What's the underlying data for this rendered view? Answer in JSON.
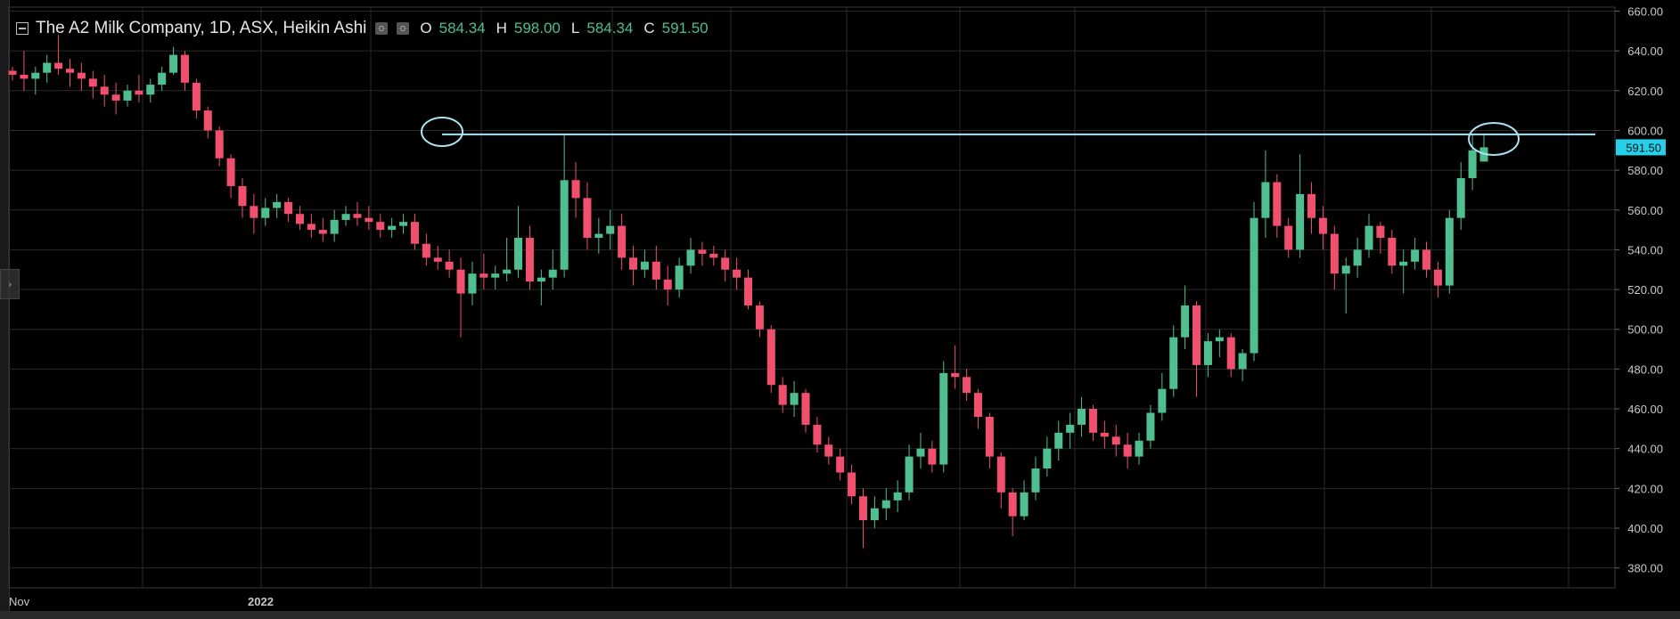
{
  "legend": {
    "title": "The A2 Milk Company, 1D, ASX, Heikin Ashi",
    "open_key": "O",
    "open_val": "584.34",
    "high_key": "H",
    "high_val": "598.00",
    "low_key": "L",
    "low_val": "584.34",
    "close_key": "C",
    "close_val": "591.50"
  },
  "colors": {
    "up": "#4fbf8f",
    "down": "#f0506e",
    "grid": "#2a2a2a",
    "annotation": "#a8e4f4",
    "axis_text": "#c8c8c8",
    "price_tag_bg": "#26d0e8"
  },
  "chart_data": {
    "type": "candlestick",
    "title": "The A2 Milk Company, 1D, ASX, Heikin Ashi",
    "ylim": [
      370,
      662
    ],
    "yticks": [
      "660.00",
      "640.00",
      "620.00",
      "600.00",
      "580.00",
      "560.00",
      "540.00",
      "520.00",
      "500.00",
      "480.00",
      "460.00",
      "440.00",
      "420.00",
      "400.00",
      "380.00"
    ],
    "xtick_labels": [
      "Nov",
      "2022"
    ],
    "last_price": "591.50",
    "resistance_level": 598,
    "annotations": [
      "horizontal line at ~598 with circles at prior high and current high"
    ],
    "ohlc": [
      [
        630,
        632,
        625,
        628
      ],
      [
        628,
        640,
        620,
        626
      ],
      [
        626,
        632,
        618,
        629
      ],
      [
        629,
        638,
        624,
        634
      ],
      [
        634,
        648,
        628,
        631
      ],
      [
        631,
        636,
        622,
        629
      ],
      [
        629,
        634,
        620,
        626
      ],
      [
        626,
        630,
        616,
        622
      ],
      [
        622,
        628,
        612,
        618
      ],
      [
        618,
        624,
        608,
        615
      ],
      [
        615,
        623,
        612,
        620
      ],
      [
        620,
        628,
        614,
        618
      ],
      [
        618,
        626,
        614,
        623
      ],
      [
        623,
        632,
        620,
        629
      ],
      [
        629,
        642,
        628,
        638
      ],
      [
        638,
        640,
        620,
        624
      ],
      [
        624,
        626,
        606,
        610
      ],
      [
        610,
        612,
        596,
        600
      ],
      [
        600,
        602,
        582,
        586
      ],
      [
        586,
        588,
        566,
        572
      ],
      [
        572,
        576,
        556,
        562
      ],
      [
        562,
        568,
        548,
        556
      ],
      [
        556,
        566,
        552,
        561
      ],
      [
        561,
        568,
        556,
        564
      ],
      [
        564,
        566,
        554,
        558
      ],
      [
        558,
        562,
        550,
        553
      ],
      [
        553,
        558,
        546,
        550
      ],
      [
        550,
        556,
        544,
        548
      ],
      [
        548,
        560,
        544,
        555
      ],
      [
        555,
        562,
        552,
        558
      ],
      [
        558,
        564,
        552,
        556
      ],
      [
        556,
        562,
        550,
        554
      ],
      [
        554,
        558,
        546,
        550
      ],
      [
        550,
        556,
        546,
        552
      ],
      [
        552,
        558,
        548,
        554
      ],
      [
        554,
        558,
        540,
        543
      ],
      [
        543,
        548,
        532,
        536
      ],
      [
        536,
        542,
        530,
        534
      ],
      [
        534,
        540,
        526,
        530
      ],
      [
        530,
        536,
        496,
        518
      ],
      [
        518,
        534,
        512,
        528
      ],
      [
        528,
        538,
        520,
        526
      ],
      [
        526,
        532,
        520,
        528
      ],
      [
        528,
        546,
        524,
        530
      ],
      [
        530,
        562,
        526,
        546
      ],
      [
        546,
        552,
        520,
        524
      ],
      [
        524,
        530,
        512,
        526
      ],
      [
        526,
        540,
        520,
        530
      ],
      [
        530,
        598,
        526,
        575
      ],
      [
        575,
        584,
        556,
        566
      ],
      [
        566,
        574,
        540,
        546
      ],
      [
        546,
        556,
        538,
        548
      ],
      [
        548,
        560,
        540,
        552
      ],
      [
        552,
        558,
        530,
        536
      ],
      [
        536,
        542,
        522,
        530
      ],
      [
        530,
        540,
        526,
        534
      ],
      [
        534,
        542,
        520,
        525
      ],
      [
        525,
        532,
        512,
        520
      ],
      [
        520,
        536,
        516,
        532
      ],
      [
        532,
        546,
        528,
        540
      ],
      [
        540,
        544,
        532,
        538
      ],
      [
        538,
        542,
        532,
        536
      ],
      [
        536,
        540,
        524,
        530
      ],
      [
        530,
        536,
        520,
        526
      ],
      [
        526,
        530,
        510,
        512
      ],
      [
        512,
        514,
        496,
        500
      ],
      [
        500,
        502,
        468,
        472
      ],
      [
        472,
        476,
        458,
        462
      ],
      [
        462,
        474,
        456,
        468
      ],
      [
        468,
        470,
        448,
        452
      ],
      [
        452,
        456,
        438,
        442
      ],
      [
        442,
        446,
        432,
        436
      ],
      [
        436,
        440,
        424,
        428
      ],
      [
        428,
        432,
        412,
        416
      ],
      [
        416,
        420,
        390,
        404
      ],
      [
        404,
        416,
        400,
        410
      ],
      [
        410,
        420,
        404,
        414
      ],
      [
        414,
        424,
        408,
        418
      ],
      [
        418,
        442,
        414,
        436
      ],
      [
        436,
        448,
        430,
        440
      ],
      [
        440,
        444,
        428,
        432
      ],
      [
        432,
        484,
        428,
        478
      ],
      [
        478,
        492,
        470,
        476
      ],
      [
        476,
        480,
        464,
        468
      ],
      [
        468,
        470,
        450,
        456
      ],
      [
        456,
        458,
        430,
        436
      ],
      [
        436,
        438,
        410,
        418
      ],
      [
        418,
        420,
        396,
        406
      ],
      [
        406,
        424,
        404,
        418
      ],
      [
        418,
        436,
        414,
        430
      ],
      [
        430,
        446,
        426,
        440
      ],
      [
        440,
        454,
        434,
        448
      ],
      [
        448,
        458,
        440,
        452
      ],
      [
        452,
        466,
        446,
        460
      ],
      [
        460,
        462,
        444,
        448
      ],
      [
        448,
        454,
        440,
        446
      ],
      [
        446,
        452,
        436,
        442
      ],
      [
        442,
        448,
        430,
        436
      ],
      [
        436,
        448,
        432,
        444
      ],
      [
        444,
        462,
        440,
        458
      ],
      [
        458,
        478,
        454,
        470
      ],
      [
        470,
        502,
        466,
        496
      ],
      [
        496,
        522,
        490,
        512
      ],
      [
        512,
        514,
        466,
        482
      ],
      [
        482,
        498,
        476,
        494
      ],
      [
        494,
        500,
        486,
        496
      ],
      [
        496,
        498,
        476,
        480
      ],
      [
        480,
        490,
        474,
        488
      ],
      [
        488,
        564,
        484,
        556
      ],
      [
        556,
        590,
        546,
        574
      ],
      [
        574,
        578,
        546,
        552
      ],
      [
        552,
        556,
        536,
        540
      ],
      [
        540,
        588,
        536,
        568
      ],
      [
        568,
        574,
        548,
        556
      ],
      [
        556,
        562,
        540,
        548
      ],
      [
        548,
        552,
        520,
        528
      ],
      [
        528,
        536,
        508,
        532
      ],
      [
        532,
        546,
        526,
        540
      ],
      [
        540,
        558,
        536,
        552
      ],
      [
        552,
        554,
        538,
        546
      ],
      [
        546,
        550,
        528,
        532
      ],
      [
        532,
        540,
        518,
        534
      ],
      [
        534,
        546,
        530,
        540
      ],
      [
        540,
        544,
        526,
        530
      ],
      [
        530,
        534,
        516,
        522
      ],
      [
        522,
        560,
        518,
        556
      ],
      [
        556,
        584,
        550,
        576
      ],
      [
        576,
        598,
        570,
        590
      ],
      [
        584.34,
        598,
        584.34,
        591.5
      ]
    ]
  }
}
